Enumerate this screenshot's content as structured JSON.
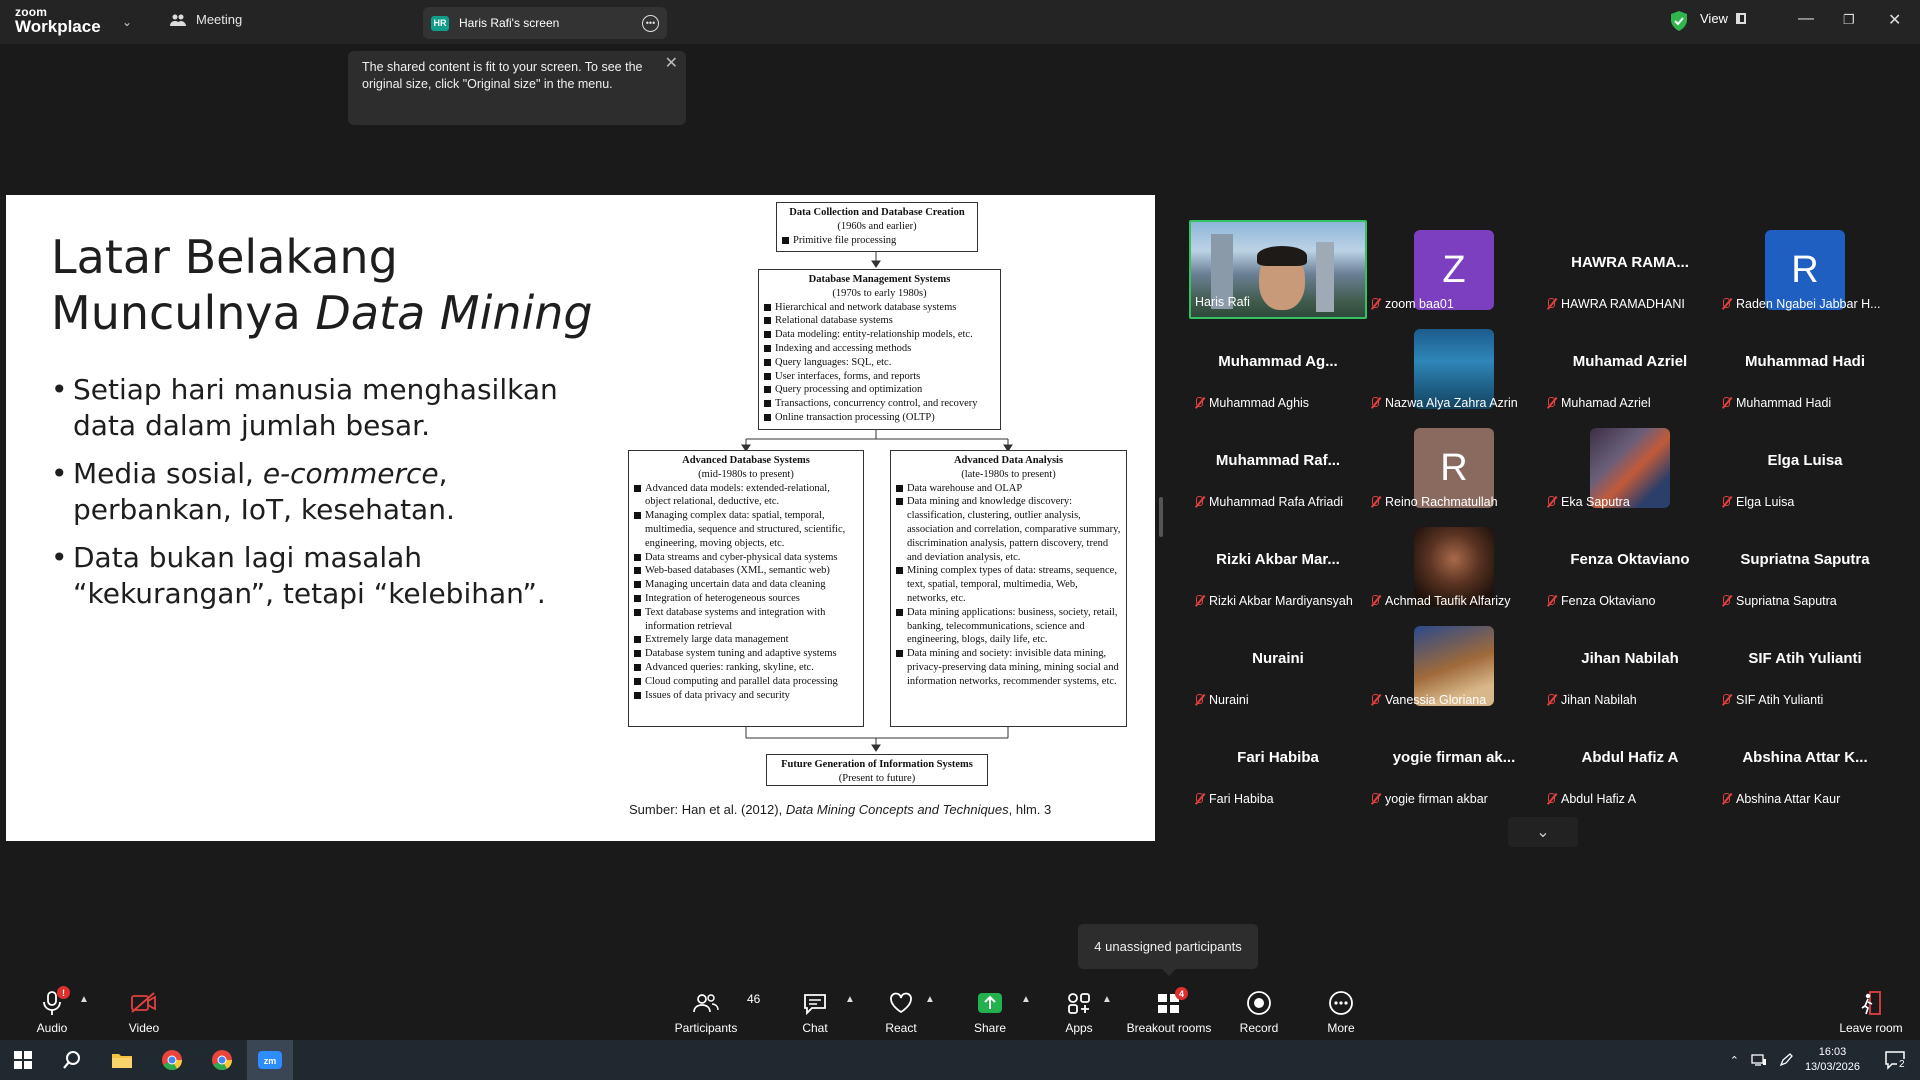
{
  "topbar": {
    "brand_top": "zoom",
    "brand_bottom": "Workplace",
    "meeting_label": "Meeting",
    "screen_badge": "HR",
    "screen_label": "Haris Rafi's screen",
    "view_label": "View"
  },
  "toast": {
    "text": "The shared content is fit to your screen. To see the original size, click \"Original size\" in the menu."
  },
  "slide": {
    "title_line1": "Latar Belakang",
    "title_line2_plain": "Munculnya ",
    "title_line2_italic": "Data Mining",
    "bullet1": "Setiap hari manusia menghasilkan data dalam jumlah besar.",
    "bullet2_italic": "e-commerce",
    "bullet2_prefix": "Media sosial, ",
    "bullet2_suffix": ", perbankan, IoT, kesehatan.",
    "bullet3": "Data bukan lagi masalah “kekurangan”, tetapi “kelebihan”.",
    "source_prefix": "Sumber: Han et al. (2012), ",
    "source_italic": "Data Mining Concepts and Techniques",
    "source_suffix": ", hlm. 3",
    "box1": {
      "title": "Data Collection and Database Creation",
      "sub": "(1960s and earlier)",
      "items": [
        "Primitive file processing"
      ]
    },
    "box2": {
      "title": "Database Management Systems",
      "sub": "(1970s to early 1980s)",
      "items": [
        "Hierarchical and network database systems",
        "Relational database systems",
        "Data modeling: entity-relationship models, etc.",
        "Indexing and accessing methods",
        "Query languages: SQL, etc.",
        "User interfaces, forms, and reports",
        "Query processing and optimization",
        "Transactions, concurrency control, and recovery",
        "Online transaction processing (OLTP)"
      ]
    },
    "box3": {
      "title": "Advanced Database Systems",
      "sub": "(mid-1980s to present)",
      "items": [
        "Advanced data models: extended-relational, object relational, deductive, etc.",
        "Managing complex data: spatial, temporal, multimedia, sequence and structured, scientific, engineering, moving objects, etc.",
        "Data streams and cyber-physical data systems",
        "Web-based databases (XML, semantic web)",
        "Managing uncertain data and data cleaning",
        "Integration of heterogeneous sources",
        "Text database systems and integration with information retrieval",
        "Extremely large data management",
        "Database system tuning and adaptive systems",
        "Advanced queries: ranking, skyline, etc.",
        "Cloud computing and parallel data processing",
        "Issues of data privacy and security"
      ]
    },
    "box4": {
      "title": "Advanced Data Analysis",
      "sub": "(late-1980s to present)",
      "items": [
        "Data warehouse and OLAP",
        "Data mining and knowledge discovery: classification, clustering, outlier analysis, association and correlation, comparative summary, discrimination analysis, pattern discovery, trend and deviation analysis, etc.",
        "Mining complex types of data: streams, sequence, text, spatial, temporal, multimedia, Web, networks, etc.",
        "Data mining applications: business, society, retail, banking, telecommunications, science and engineering, blogs, daily life, etc.",
        "Data mining and society: invisible data mining, privacy-preserving data mining, mining social and information networks, recommender systems, etc."
      ]
    },
    "box5": {
      "title": "Future Generation of Information Systems",
      "sub": "(Present to future)"
    }
  },
  "participants": [
    {
      "big": "",
      "name": "Haris Rafi",
      "avatar": "video",
      "muted": false
    },
    {
      "big": "",
      "name": "zoom baa01",
      "avatar": "Z",
      "color": "#7b3fbf",
      "muted": true
    },
    {
      "big": "HAWRA RAMA...",
      "name": "HAWRA RAMADHANI",
      "muted": true
    },
    {
      "big": "",
      "name": "Raden Ngabei Jabbar H...",
      "avatar": "R",
      "color": "#1f5fc2",
      "muted": true
    },
    {
      "big": "Muhammad Ag...",
      "name": "Muhammad Aghis",
      "muted": true
    },
    {
      "big": "",
      "name": "Nazwa Alya Zahra Azrin",
      "avatar": "photo-ocean",
      "muted": true
    },
    {
      "big": "Muhamad Azriel",
      "name": "Muhamad Azriel",
      "muted": true
    },
    {
      "big": "Muhammad Hadi",
      "name": "Muhammad Hadi",
      "muted": true
    },
    {
      "big": "Muhammad Raf...",
      "name": "Muhammad Rafa Afriadi",
      "muted": true
    },
    {
      "big": "",
      "name": "Reino Rachmatullah",
      "avatar": "R",
      "color": "#8a6a5e",
      "muted": true
    },
    {
      "big": "",
      "name": "Eka Saputra",
      "avatar": "photo-city",
      "muted": true
    },
    {
      "big": "Elga Luisa",
      "name": "Elga Luisa",
      "muted": true
    },
    {
      "big": "Rizki Akbar Mar...",
      "name": "Rizki Akbar Mardiyansyah",
      "muted": true
    },
    {
      "big": "",
      "name": "Achmad Taufik Alfarizy",
      "avatar": "photo-person",
      "muted": true
    },
    {
      "big": "Fenza Oktaviano",
      "name": "Fenza Oktaviano",
      "muted": true
    },
    {
      "big": "Supriatna Saputra",
      "name": "Supriatna Saputra",
      "muted": true
    },
    {
      "big": "Nuraini",
      "name": "Nuraini",
      "muted": true
    },
    {
      "big": "",
      "name": "Vanessia Gloriana",
      "avatar": "photo-violin",
      "muted": true
    },
    {
      "big": "Jihan Nabilah",
      "name": "Jihan Nabilah",
      "muted": true
    },
    {
      "big": "SIF Atih Yulianti",
      "name": "SIF Atih Yulianti",
      "muted": true
    },
    {
      "big": "Fari Habiba",
      "name": "Fari Habiba",
      "muted": true
    },
    {
      "big": "yogie firman ak...",
      "name": "yogie firman akbar",
      "muted": true
    },
    {
      "big": "Abdul Hafiz A",
      "name": "Abdul Hafiz A",
      "muted": true
    },
    {
      "big": "Abshina Attar K...",
      "name": "Abshina Attar Kaur",
      "muted": true
    }
  ],
  "tooltip": {
    "text": "4 unassigned participants"
  },
  "toolbar": {
    "audio": "Audio",
    "video": "Video",
    "participants": "Participants",
    "participants_count": "46",
    "chat": "Chat",
    "react": "React",
    "share": "Share",
    "apps": "Apps",
    "breakout": "Breakout rooms",
    "breakout_badge": "4",
    "record": "Record",
    "more": "More",
    "leave": "Leave room"
  },
  "taskbar": {
    "time": "16:03",
    "date": "13/03/2026",
    "notif_count": "2"
  }
}
